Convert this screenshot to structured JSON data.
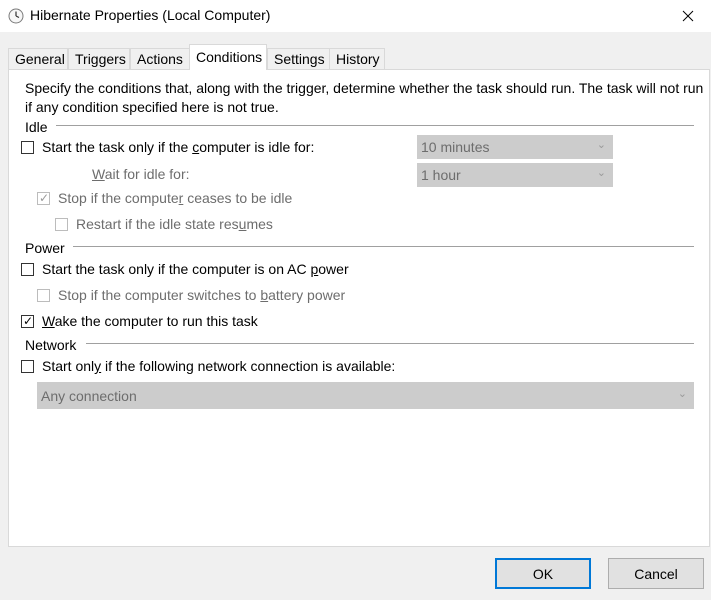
{
  "window": {
    "title": "Hibernate Properties (Local Computer)",
    "icon": "clock-icon",
    "close_icon": "close-icon"
  },
  "tabs": [
    {
      "label": "General",
      "active": false
    },
    {
      "label": "Triggers",
      "active": false
    },
    {
      "label": "Actions",
      "active": false
    },
    {
      "label": "Conditions",
      "active": true
    },
    {
      "label": "Settings",
      "active": false
    },
    {
      "label": "History",
      "active": false
    }
  ],
  "conditions": {
    "description": "Specify the conditions that, along with the trigger, determine whether the task should run.  The task will not run  if any condition specified here is not true.",
    "idle": {
      "group_label": "Idle",
      "start_if_idle": {
        "label": "Start the task only if the computer is idle for:",
        "checked": false,
        "enabled": true
      },
      "idle_duration": {
        "value": "10 minutes",
        "enabled": false
      },
      "wait_label": "Wait for idle for:",
      "wait_duration": {
        "value": "1 hour",
        "enabled": false
      },
      "stop_if_ceases": {
        "label": "Stop if the computer ceases to be idle",
        "checked": true,
        "enabled": false
      },
      "restart_if_resumes": {
        "label": "Restart if the idle state resumes",
        "checked": false,
        "enabled": false
      }
    },
    "power": {
      "group_label": "Power",
      "start_on_ac": {
        "label": "Start the task only if the computer is on AC power",
        "checked": false,
        "enabled": true
      },
      "stop_on_battery": {
        "label": "Stop if the computer switches to battery power",
        "checked": false,
        "enabled": false
      },
      "wake_to_run": {
        "label": "Wake the computer to run this task",
        "checked": true,
        "enabled": true
      }
    },
    "network": {
      "group_label": "Network",
      "start_if_network": {
        "label": "Start only if the following network connection is available:",
        "checked": false,
        "enabled": true
      },
      "connection": {
        "value": "Any connection",
        "enabled": false
      }
    }
  },
  "buttons": {
    "ok": "OK",
    "cancel": "Cancel"
  },
  "colors": {
    "background": "#f0f0f0",
    "panel": "#ffffff",
    "disabled_combo": "#cccccc",
    "default_button_border": "#0078d7"
  }
}
